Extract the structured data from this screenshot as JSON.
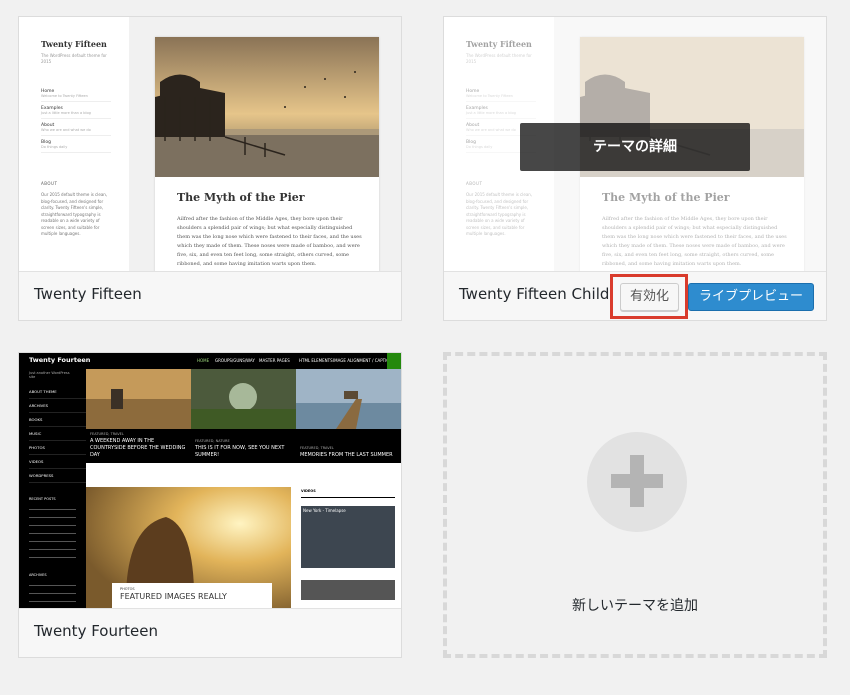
{
  "themes": [
    {
      "name": "Twenty Fifteen",
      "preview": {
        "site_title": "Twenty Fifteen",
        "tagline": "The WordPress default theme for 2015",
        "menu": [
          {
            "label": "Home",
            "sub": "Welcome to Twenty Fifteen"
          },
          {
            "label": "Examples",
            "sub": "Just a little more than a blog"
          },
          {
            "label": "About",
            "sub": "Who we are and what we do"
          },
          {
            "label": "Blog",
            "sub": "Do things daily"
          }
        ],
        "about_heading": "ABOUT",
        "about_text": "Our 2015 default theme is clean, blog-focused, and designed for clarity. Twenty Fifteen's simple, straightforward typography is readable on a wide variety of screen sizes, and suitable for multiple languages.",
        "post_title": "The Myth of the Pier",
        "post_body": "Ailfred after the fashion of the Middle Ages, they bore upon their shoulders a splendid pair of wings; but what especially distinguished them was the long nose which were fastened to their faces, and the uses which they made of them. These noses were made of bamboo, and were five, six, and even ten feet long, some straight, others curved, some ribboned, and some having imitation warts upon them."
      }
    },
    {
      "name": "Twenty Fifteen Child",
      "overlay_label": "テーマの詳細",
      "activate_label": "有効化",
      "preview_label": "ライブプレビュー"
    },
    {
      "name": "Twenty Fourteen",
      "preview": {
        "logo": "Twenty Fourteen",
        "tagline": "Just another WordPress site",
        "nav": [
          "HOME",
          "GROUPS/GUNS/WAY",
          "MASTER PAGES",
          "HTML ELEMENTS",
          "IMAGE ALIGNMENT / CAPTIONS"
        ],
        "side_items": [
          "ABOUT THEME",
          "ARCHIVES",
          "BOOKS",
          "MUSIC",
          "PHOTOS",
          "VIDEOS",
          "WORDPRESS"
        ],
        "tiles": [
          {
            "cat": "FEATURED, TRAVEL",
            "title": "A WEEKEND AWAY IN THE COUNTRYSIDE BEFORE THE WEDDING DAY"
          },
          {
            "cat": "FEATURED, NATURE",
            "title": "THIS IS IT FOR NOW, SEE YOU NEXT SUMMER!"
          },
          {
            "cat": "FEATURED, TRAVEL",
            "title": "MEMORIES FROM THE LAST SUMMER"
          }
        ],
        "recent_heading": "RECENT POSTS",
        "archives_heading": "ARCHIVES",
        "big_cat": "PHOTOS",
        "big_title": "FEATURED IMAGES REALLY",
        "videos_heading": "VIDEOS",
        "video_title": "New York - Timelapse"
      }
    }
  ],
  "add_theme_label": "新しいテーマを追加",
  "colors": {
    "primary_button": "#2e8ccf",
    "highlight": "#d93b2c",
    "t14_accent": "#24890d"
  }
}
